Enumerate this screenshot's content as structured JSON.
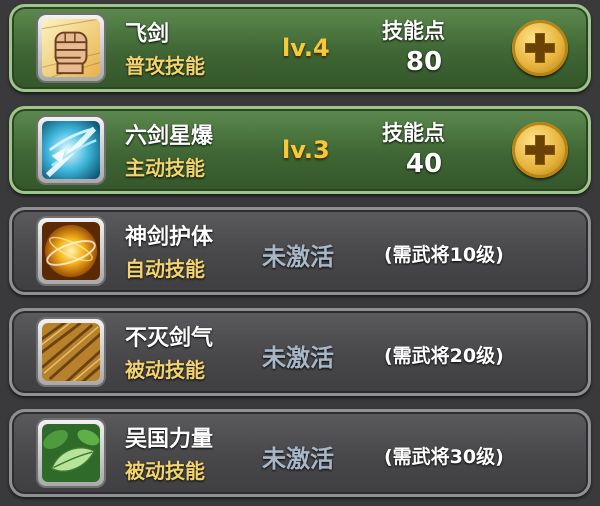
{
  "skills": [
    {
      "name": "飞剑",
      "type": "普攻技能",
      "level": "lv.4",
      "points_label": "技能点",
      "points": "80",
      "icon": "fist-icon"
    },
    {
      "name": "六剑星爆",
      "type": "主动技能",
      "level": "lv.3",
      "points_label": "技能点",
      "points": "40",
      "icon": "sword-burst-icon"
    },
    {
      "name": "神剑护体",
      "type": "自动技能",
      "status": "未激活",
      "requirement": "(需武将10级)",
      "icon": "golden-orb-icon"
    },
    {
      "name": "不灭剑气",
      "type": "被动技能",
      "status": "未激活",
      "requirement": "(需武将20级)",
      "icon": "sword-slash-icon"
    },
    {
      "name": "吴国力量",
      "type": "被动技能",
      "status": "未激活",
      "requirement": "(需武将30级)",
      "icon": "leaf-icon"
    }
  ],
  "colors": {
    "active_row": "#3f6634",
    "locked_row": "#48484b",
    "skill_type": "#f3d36b",
    "level": "#f7c93a",
    "inactive_status": "#a7b7c7",
    "plus_button": "#e5b23a"
  }
}
